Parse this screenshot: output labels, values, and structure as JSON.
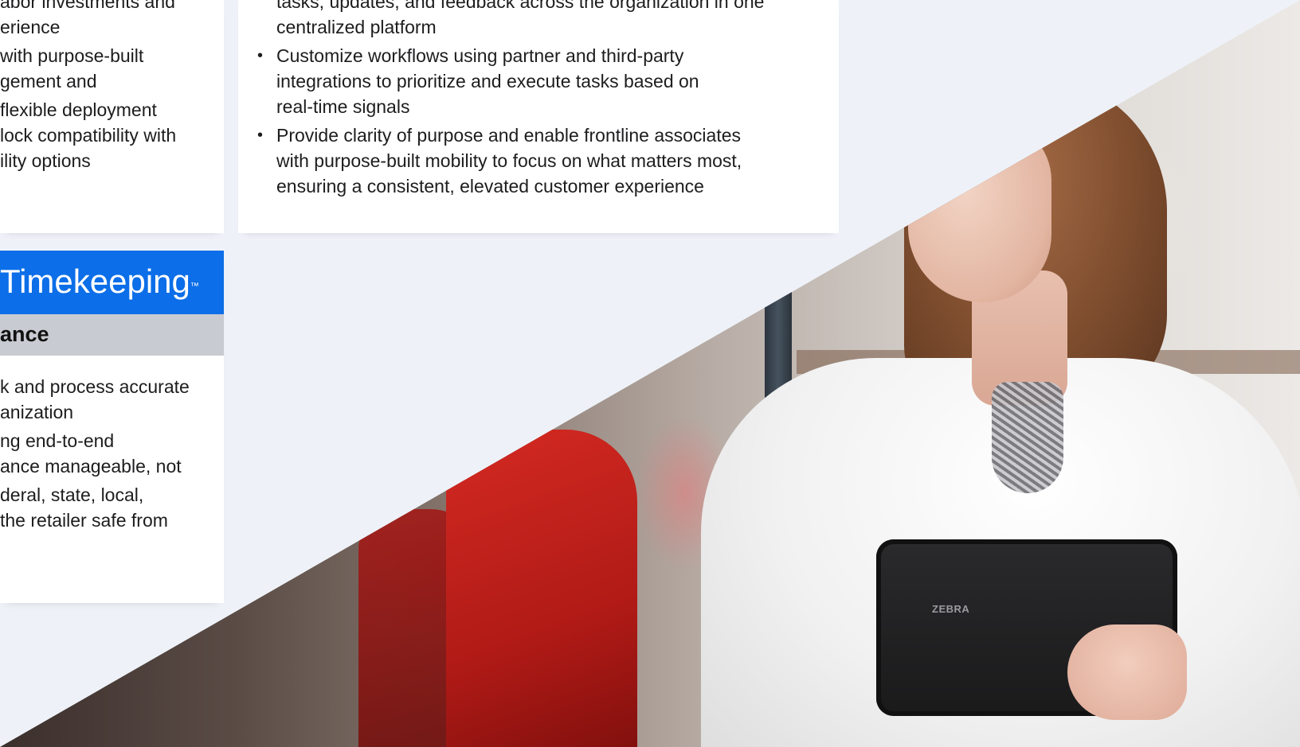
{
  "colors": {
    "brand_blue": "#0c6ee8",
    "subheader_gray": "#c8cbd1",
    "page_bg": "#eef2f8",
    "card_bg": "#ffffff"
  },
  "left_top_card": {
    "bullets": [
      "abor investments and\nerience",
      "with purpose-built\ngement and",
      " flexible deployment\nlock compatibility with\nility options"
    ]
  },
  "center_card": {
    "bullets": [
      "tasks, updates, and feedback across the organization in one\ncentralized platform",
      "Customize workflows using partner and third-party\nintegrations to prioritize and execute tasks based on\nreal-time signals",
      "Provide clarity of purpose and enable frontline associates\nwith purpose-built mobility to focus on what matters most,\nensuring a consistent, elevated customer experience"
    ]
  },
  "timekeeping_card": {
    "title": "Timekeeping",
    "trademark": "™",
    "subtitle": "ance",
    "bullets": [
      "k and process accurate\nanization",
      "ng end-to-end\nance manageable, not",
      "deral, state, local,\nthe retailer safe from"
    ]
  },
  "photo": {
    "tablet_brand": "ZEBRA"
  }
}
